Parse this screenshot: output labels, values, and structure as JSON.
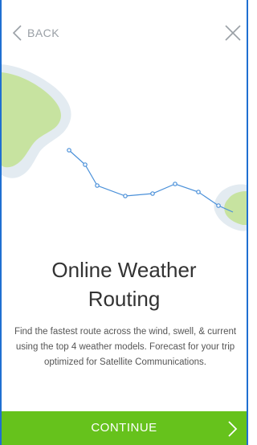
{
  "header": {
    "back_label": "BACK"
  },
  "content": {
    "title_line1": "Online Weather",
    "title_line2": "Routing",
    "description": "Find the fastest route across the wind, swell, & current using the top 4 weather models. Forecast for your trip optimized for Satellite Communications."
  },
  "footer": {
    "continue_label": "CONTINUE"
  },
  "icons": {
    "back": "chevron-left-icon",
    "close": "close-icon",
    "continue": "chevron-right-icon"
  },
  "colors": {
    "accent_green": "#66c21c",
    "route_blue": "#4a90d9",
    "island_green": "#c7e3a0",
    "island_halo": "#e3ebf1",
    "frame_blue": "#1f6fd1"
  }
}
